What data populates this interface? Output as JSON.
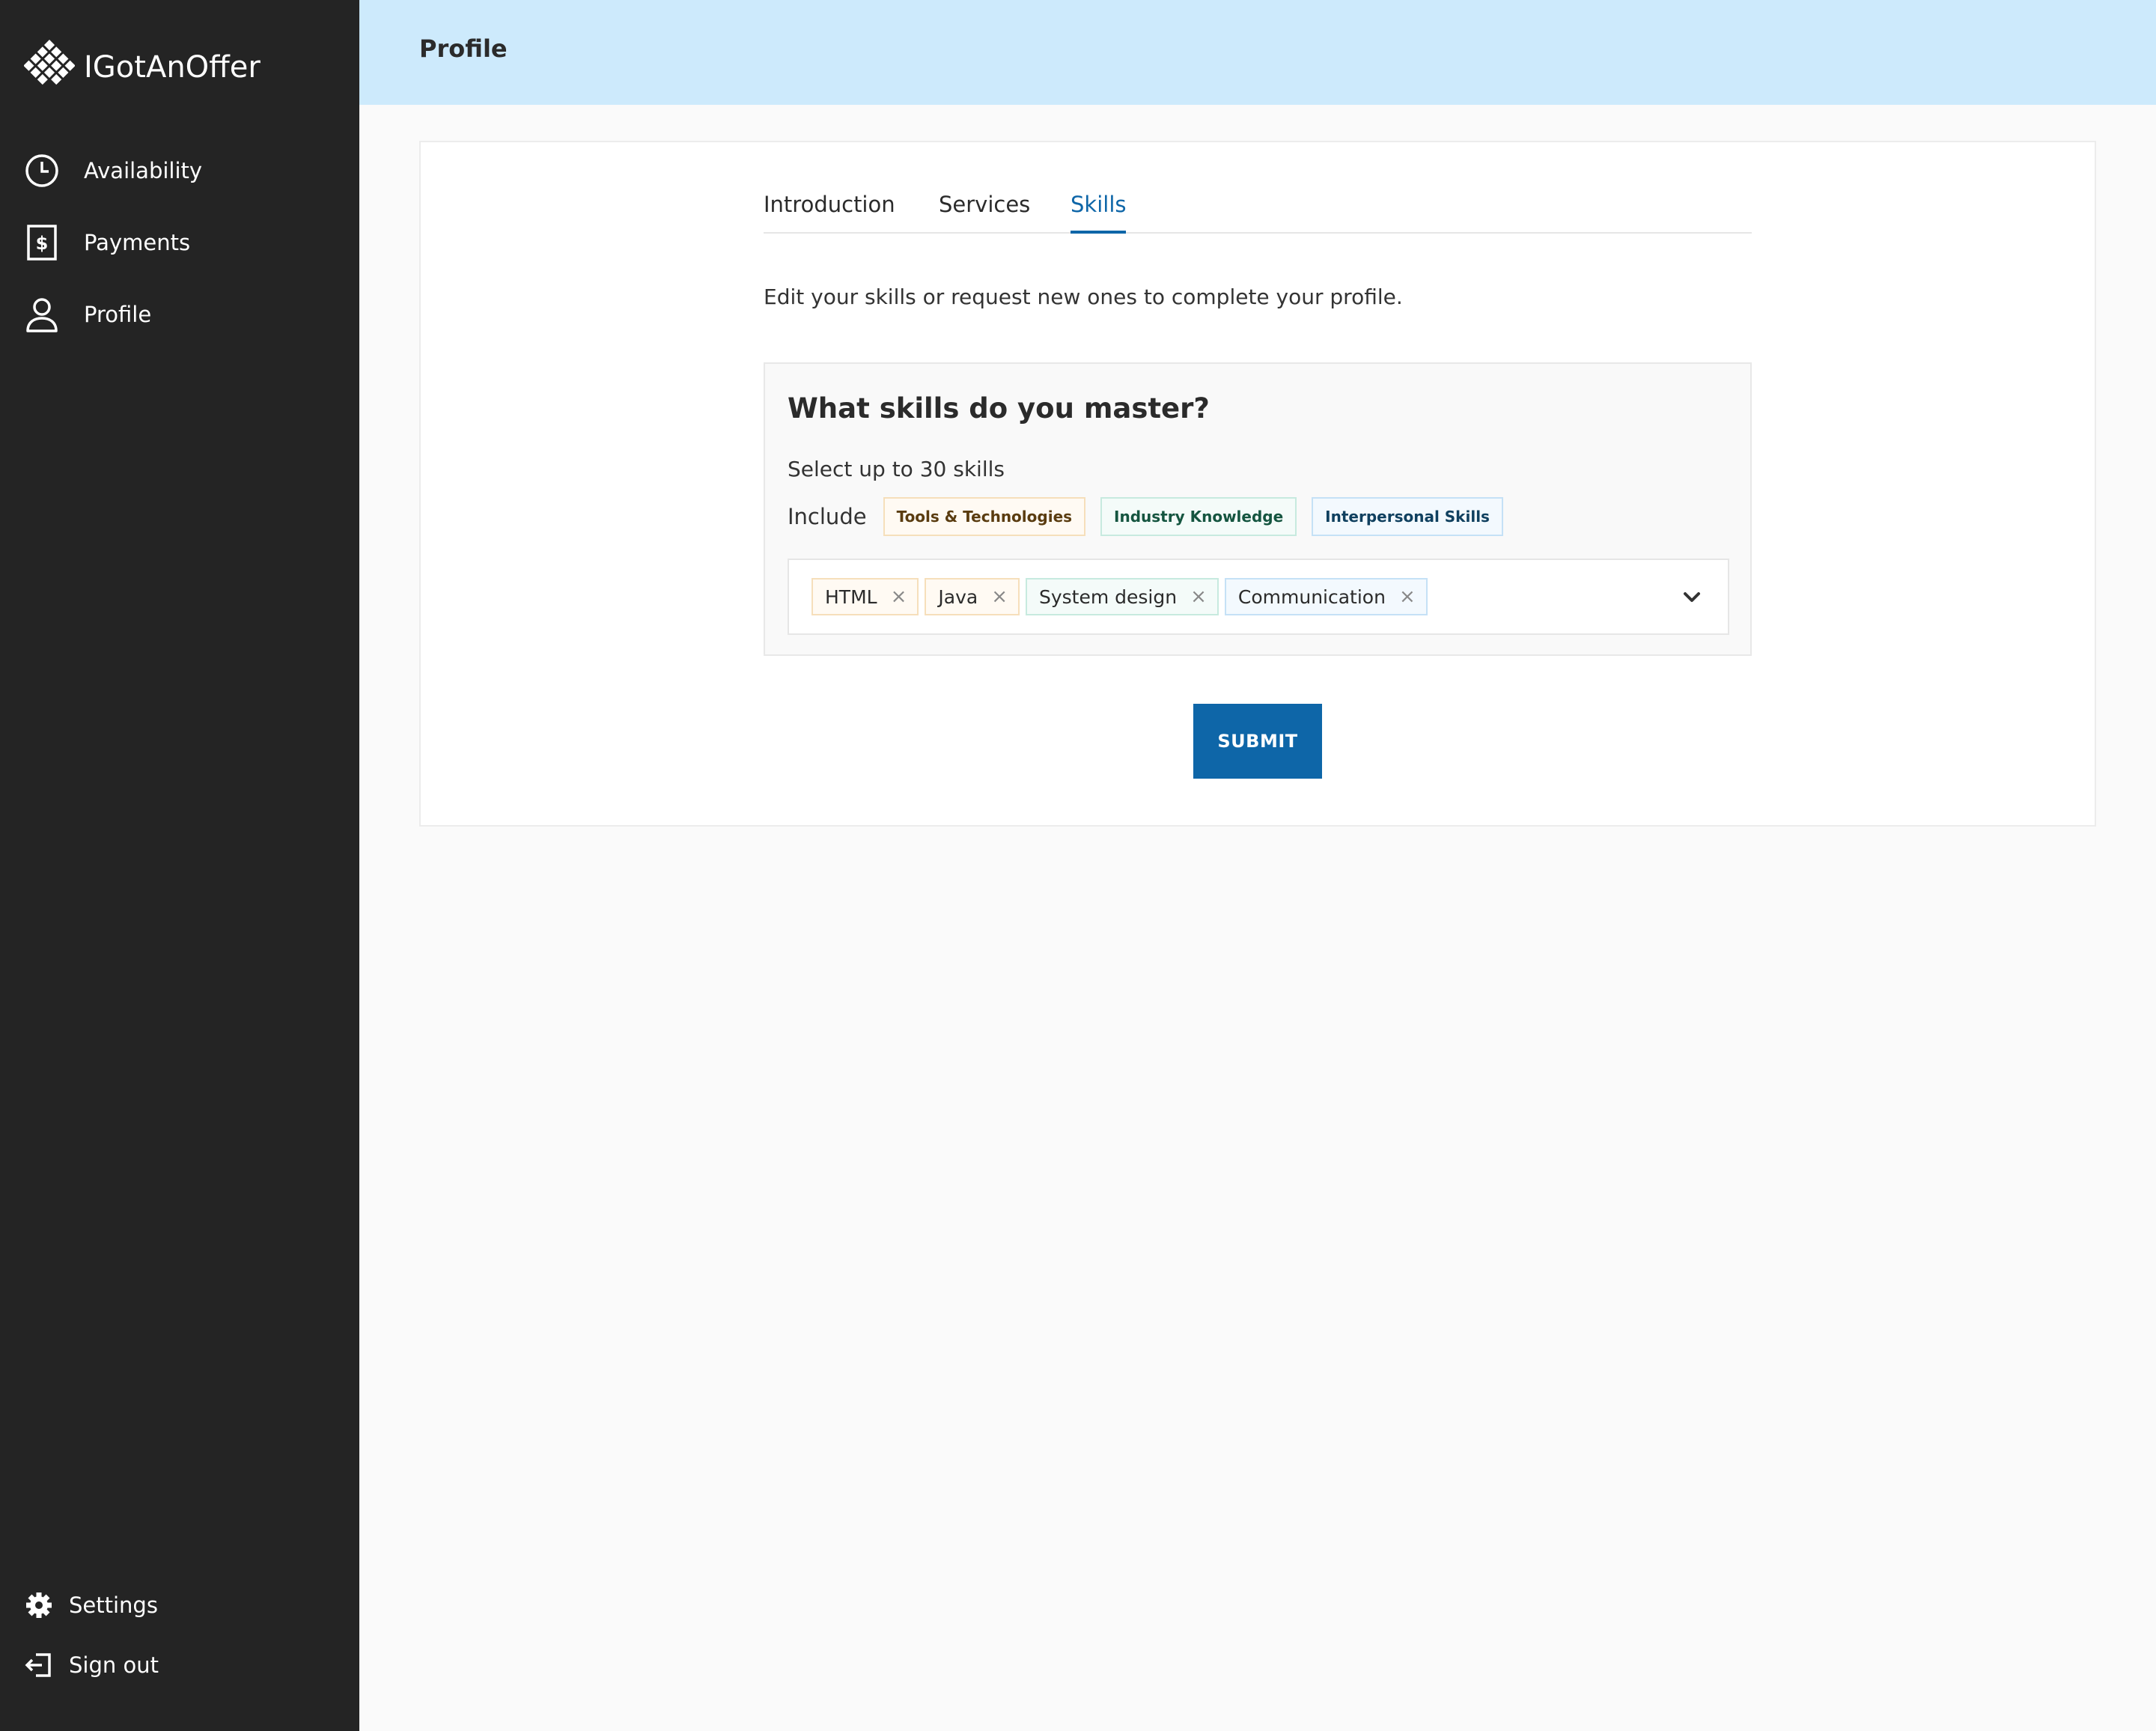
{
  "brand": {
    "name": "IGotAnOffer",
    "icon": "diamond-grid-logo-icon"
  },
  "sidebar": {
    "items": [
      {
        "label": "Availability",
        "icon": "clock-icon"
      },
      {
        "label": "Payments",
        "icon": "dollar-icon"
      },
      {
        "label": "Profile",
        "icon": "user-icon"
      }
    ],
    "bottom": [
      {
        "label": "Settings",
        "icon": "gear-icon"
      },
      {
        "label": "Sign out",
        "icon": "sign-out-icon"
      }
    ]
  },
  "header": {
    "title": "Profile"
  },
  "tabs": [
    {
      "label": "Introduction",
      "active": false
    },
    {
      "label": "Services",
      "active": false
    },
    {
      "label": "Skills",
      "active": true
    }
  ],
  "intro_text": "Edit your skills or request new ones to complete your profile.",
  "skills": {
    "title": "What skills do you master?",
    "subtitle": "Select up to 30 skills",
    "include_label": "Include",
    "categories": [
      {
        "label": "Tools & Technologies",
        "color": "#f6dfbb"
      },
      {
        "label": "Industry Knowledge",
        "color": "#c7eadf"
      },
      {
        "label": "Interpersonal Skills",
        "color": "#c5e1f6"
      }
    ],
    "selected": [
      {
        "label": "HTML",
        "category": "Tools & Technologies"
      },
      {
        "label": "Java",
        "category": "Tools & Technologies"
      },
      {
        "label": "System design",
        "category": "Industry Knowledge"
      },
      {
        "label": "Communication",
        "category": "Interpersonal Skills"
      }
    ],
    "remove_glyph": "×"
  },
  "submit_label": "SUBMIT",
  "colors": {
    "sidebar_bg": "#242424",
    "header_bg": "#cdeafc",
    "accent": "#0e66a8"
  }
}
